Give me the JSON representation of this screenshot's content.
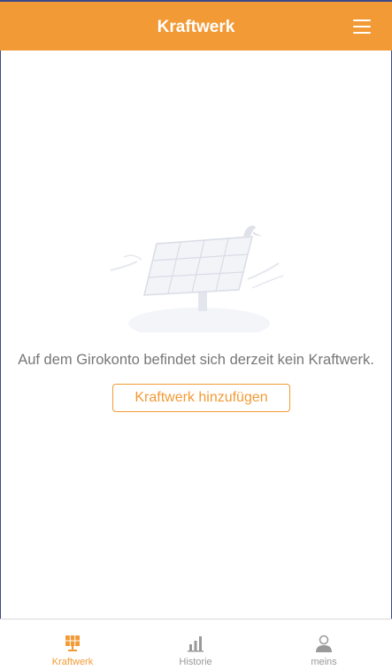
{
  "header": {
    "title": "Kraftwerk",
    "menu_icon": "hamburger-menu-icon"
  },
  "empty_state": {
    "illustration": "solar-panel-illustration",
    "message": "Auf dem Girokonto befindet sich derzeit kein Kraftwerk.",
    "button_label": "Kraftwerk hinzufügen"
  },
  "tabbar": {
    "items": [
      {
        "label": "Kraftwerk",
        "icon": "solar-panel-icon",
        "active": true
      },
      {
        "label": "Historie",
        "icon": "bar-chart-icon",
        "active": false
      },
      {
        "label": "meins",
        "icon": "person-icon",
        "active": false
      }
    ]
  },
  "colors": {
    "accent": "#f29a35",
    "inactive": "#999999",
    "text": "#777777"
  }
}
